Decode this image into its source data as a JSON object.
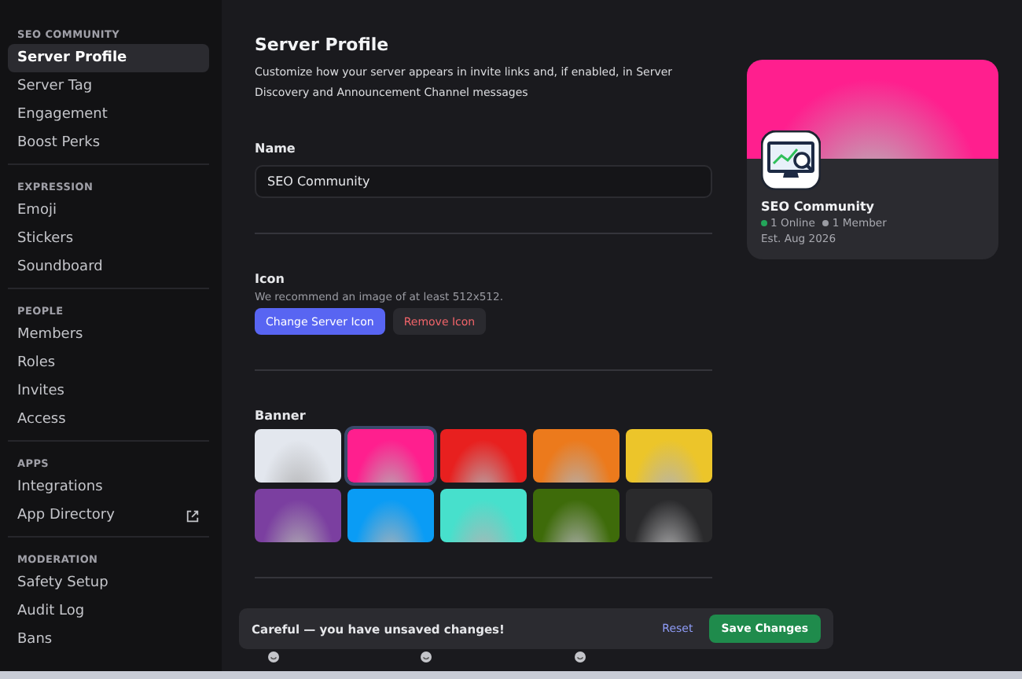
{
  "sidebar": {
    "sections": [
      {
        "heading": "SEO COMMUNITY",
        "items": [
          {
            "label": "Server Profile",
            "selected": true
          },
          {
            "label": "Server Tag",
            "selected": false
          },
          {
            "label": "Engagement",
            "selected": false
          },
          {
            "label": "Boost Perks",
            "selected": false
          }
        ]
      },
      {
        "heading": "EXPRESSION",
        "items": [
          {
            "label": "Emoji",
            "selected": false
          },
          {
            "label": "Stickers",
            "selected": false
          },
          {
            "label": "Soundboard",
            "selected": false
          }
        ]
      },
      {
        "heading": "PEOPLE",
        "items": [
          {
            "label": "Members",
            "selected": false
          },
          {
            "label": "Roles",
            "selected": false
          },
          {
            "label": "Invites",
            "selected": false
          },
          {
            "label": "Access",
            "selected": false
          }
        ]
      },
      {
        "heading": "APPS",
        "items": [
          {
            "label": "Integrations",
            "selected": false
          },
          {
            "label": "App Directory",
            "selected": false,
            "external": true
          }
        ]
      },
      {
        "heading": "MODERATION",
        "items": [
          {
            "label": "Safety Setup",
            "selected": false
          },
          {
            "label": "Audit Log",
            "selected": false
          },
          {
            "label": "Bans",
            "selected": false
          }
        ]
      }
    ]
  },
  "page": {
    "title": "Server Profile",
    "description": "Customize how your server appears in invite links and, if enabled, in Server Discovery and Announcement Channel messages",
    "name": {
      "label": "Name",
      "value": "SEO Community"
    },
    "icon": {
      "label": "Icon",
      "hint": "We recommend an image of at least 512x512.",
      "buttons": [
        {
          "label": "Change Server Icon",
          "kind": "primary"
        },
        {
          "label": "Remove Icon",
          "kind": "danger"
        }
      ]
    },
    "banner": {
      "label": "Banner",
      "swatches": [
        {
          "color": "#e3e7ee",
          "selected": false
        },
        {
          "color": "#ff1f8e",
          "selected": true
        },
        {
          "color": "#e8201f",
          "selected": false
        },
        {
          "color": "#ec7a1c",
          "selected": false
        },
        {
          "color": "#ecc52a",
          "selected": false
        },
        {
          "color": "#7b3fa0",
          "selected": false
        },
        {
          "color": "#0a9cf5",
          "selected": false
        },
        {
          "color": "#47e0cc",
          "selected": false
        },
        {
          "color": "#3e6b0a",
          "selected": false
        },
        {
          "color": "#2a2a2c",
          "selected": false
        }
      ]
    }
  },
  "preview": {
    "name": "SEO Community",
    "online": "1 Online",
    "members": "1 Member",
    "established": "Est. Aug 2026"
  },
  "unsaved_bar": {
    "message": "Careful — you have unsaved changes!",
    "reset": "Reset",
    "save": "Save Changes"
  }
}
